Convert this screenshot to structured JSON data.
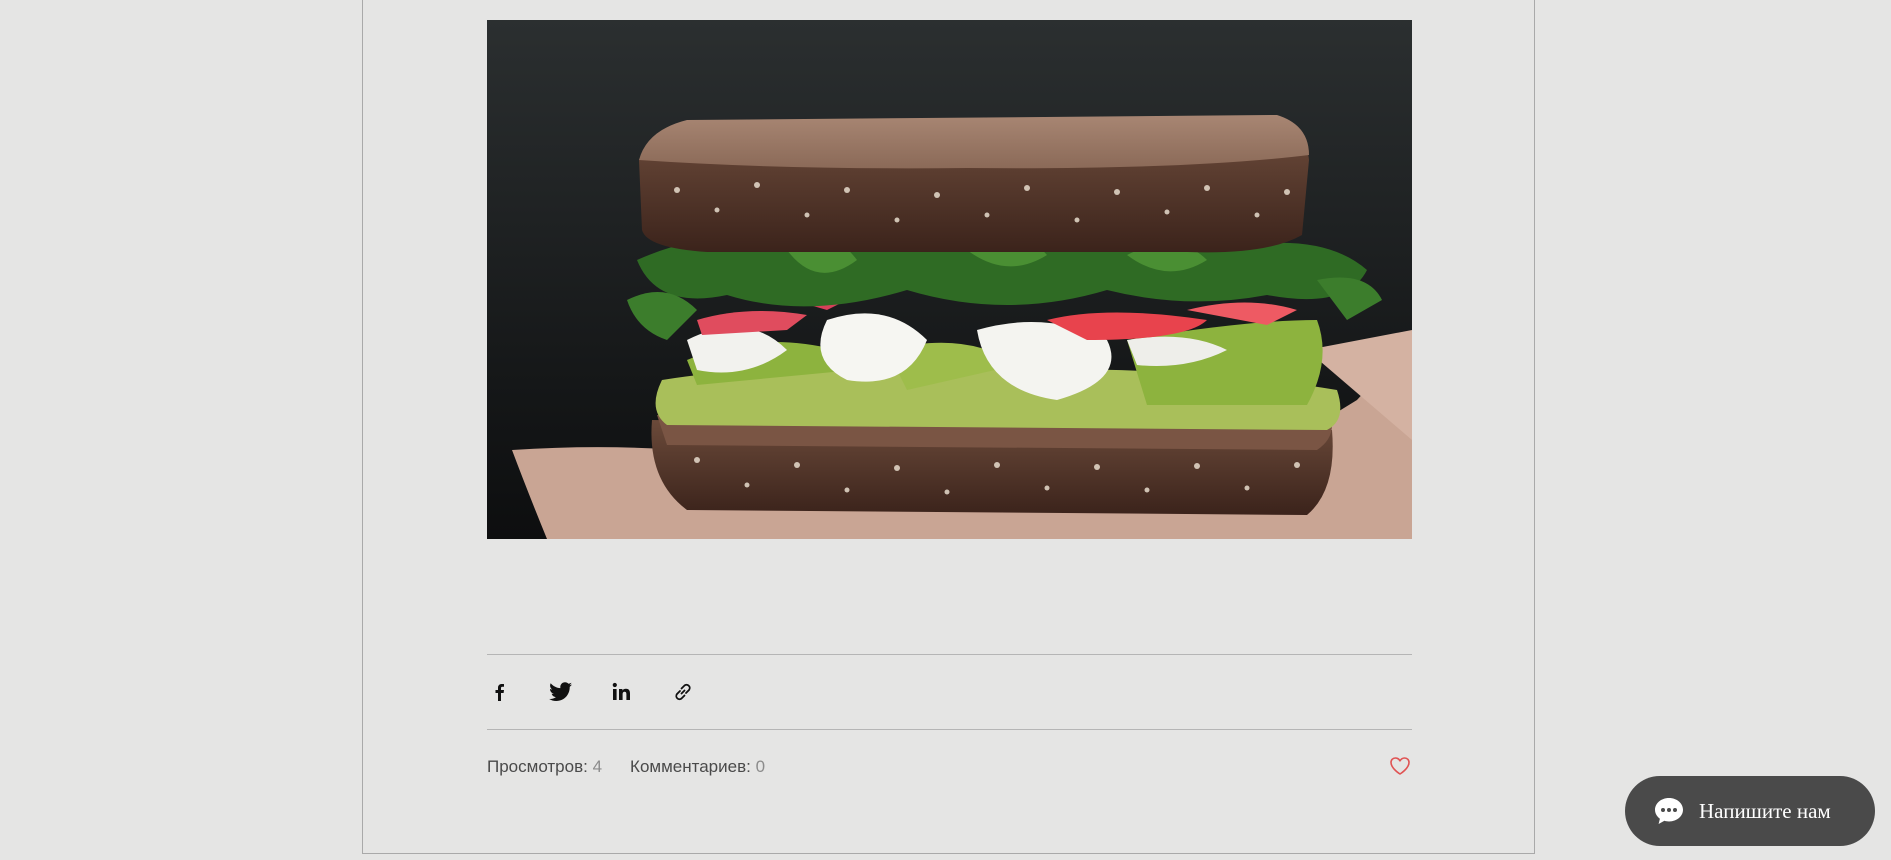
{
  "post": {
    "image": {
      "alt_icon": "sandwich-photo",
      "background_color": "#1b1d1e"
    },
    "share": {
      "facebook_icon": "facebook-icon",
      "twitter_icon": "twitter-icon",
      "linkedin_icon": "linkedin-icon",
      "link_icon": "link-icon"
    },
    "stats": {
      "views_label": "Просмотров",
      "views_sep": ": ",
      "views_count": "4",
      "comments_label": "Комментариев",
      "comments_sep": ": ",
      "comments_count": "0"
    },
    "like": {
      "icon": "heart-icon",
      "color": "#e05353"
    }
  },
  "chat": {
    "label": "Напишите нам",
    "icon": "chat-bubble-icon",
    "background": "#4a4a4a"
  }
}
